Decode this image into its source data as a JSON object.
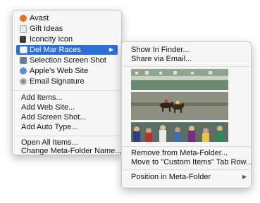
{
  "main_menu": {
    "items": [
      {
        "label": "Avast",
        "icon": "avast-icon",
        "color": "#e8731c"
      },
      {
        "label": "Gift Ideas",
        "icon": "document-icon",
        "color": "#9aa3ad"
      },
      {
        "label": "Iconcity Icon",
        "icon": "app-icon",
        "color": "#3a3a3a"
      },
      {
        "label": "Del Mar Races",
        "icon": "folder-icon",
        "color": "#f4f4f4",
        "selected": true
      },
      {
        "label": "Selection Screen Shot",
        "icon": "screenshot-icon",
        "color": "#6a7f96"
      },
      {
        "label": "Apple's Web Site",
        "icon": "globe-icon",
        "color": "#5d8fd1"
      },
      {
        "label": "Email Signature",
        "icon": "gear-icon",
        "color": "#8a8a8a"
      }
    ],
    "actions_group1": [
      "Add Items...",
      "Add Web Site...",
      "Add Screen Shot...",
      "Add Auto Type..."
    ],
    "actions_group2": [
      "Open All Items...",
      "Change Meta-Folder Name..."
    ]
  },
  "sub_menu": {
    "items_top": [
      "Show In Finder...",
      "Share via Email..."
    ],
    "items_mid": [
      "Remove from Meta-Folder...",
      "Move to \"Custom Items\" Tab Row..."
    ],
    "position_item": "Position in Meta-Folder",
    "preview_icon": "horse-race-photo"
  },
  "colors": {
    "selection": "#2f6ed6",
    "menu_bg": "#f6f6f6"
  }
}
